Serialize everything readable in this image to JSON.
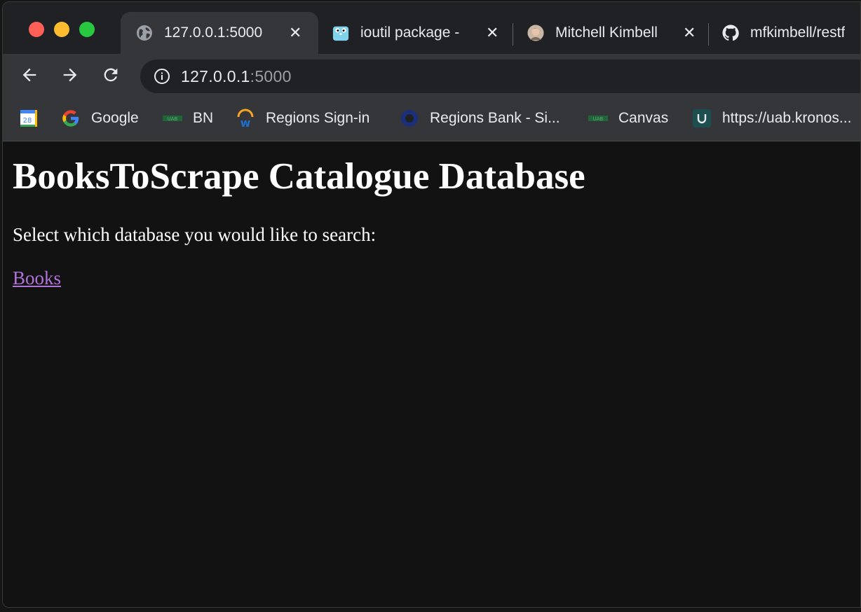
{
  "window": {
    "controls": [
      "close",
      "minimize",
      "zoom"
    ]
  },
  "tabs": [
    {
      "title": "127.0.0.1:5000",
      "icon": "globe-icon",
      "active": true
    },
    {
      "title": "ioutil package -",
      "icon": "go-gopher-icon",
      "active": false
    },
    {
      "title": "Mitchell Kimbell",
      "icon": "profile-avatar-icon",
      "active": false
    },
    {
      "title": "mfkimbell/restf",
      "icon": "github-icon",
      "active": false
    }
  ],
  "toolbar": {
    "back": "back-arrow-icon",
    "forward": "forward-arrow-icon",
    "reload": "reload-icon",
    "url_host": "127.0.0.1",
    "url_port": ":5000"
  },
  "bookmarks": [
    {
      "label": "",
      "icon": "calendar-icon",
      "badge": "28"
    },
    {
      "label": "Google",
      "icon": "google-icon"
    },
    {
      "label": "BN",
      "icon": "uab-icon"
    },
    {
      "label": "Regions Sign-in",
      "icon": "workday-icon"
    },
    {
      "label": "Regions Bank - Si...",
      "icon": "regions-ring-icon"
    },
    {
      "label": "Canvas",
      "icon": "uab-icon"
    },
    {
      "label": "https://uab.kronos...",
      "icon": "kronos-icon"
    }
  ],
  "page": {
    "heading": "BooksToScrape Catalogue Database",
    "prompt": "Select which database you would like to search:",
    "link": "Books"
  },
  "colors": {
    "page_bg": "#121212",
    "link": "#b073d8",
    "chrome_bar": "#35363a",
    "tab_strip": "#202124"
  }
}
